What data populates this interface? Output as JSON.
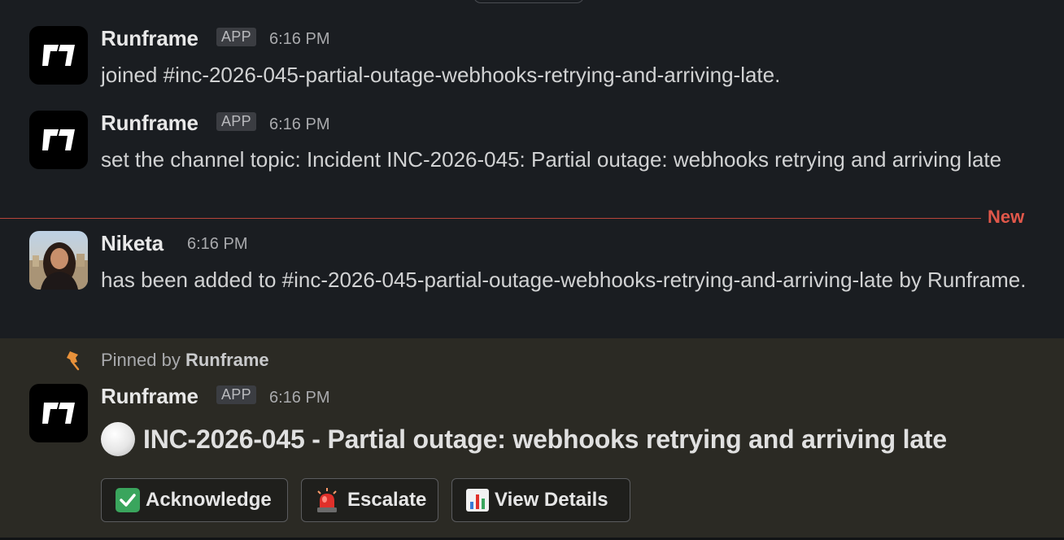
{
  "messages": [
    {
      "sender": "Runframe",
      "badge": "APP",
      "time": "6:16 PM",
      "text": "joined #inc-2026-045-partial-outage-webhooks-retrying-and-arriving-late."
    },
    {
      "sender": "Runframe",
      "badge": "APP",
      "time": "6:16 PM",
      "text": "set the channel topic: Incident INC-2026-045: Partial outage: webhooks retrying and arriving late"
    },
    {
      "sender": "Niketa",
      "time": "6:16 PM",
      "text": "has been added to #inc-2026-045-partial-outage-webhooks-retrying-and-arriving-late by Runframe."
    }
  ],
  "divider": {
    "label": "New",
    "color": "#e0574a"
  },
  "pinned": {
    "prefix": "Pinned by",
    "by": "Runframe",
    "sender": "Runframe",
    "badge": "APP",
    "time": "6:16 PM",
    "status_icon": "white-circle-icon",
    "title": "INC-2026-045 - Partial outage: webhooks retrying and arriving late",
    "buttons": [
      {
        "icon": "check-mark-icon",
        "label": "Acknowledge"
      },
      {
        "icon": "siren-icon",
        "label": "Escalate"
      },
      {
        "icon": "bar-chart-icon",
        "label": "View Details"
      }
    ]
  },
  "colors": {
    "background": "#1a1d21",
    "pinned_background": "#2b2a24",
    "new_divider": "#b8453a"
  }
}
